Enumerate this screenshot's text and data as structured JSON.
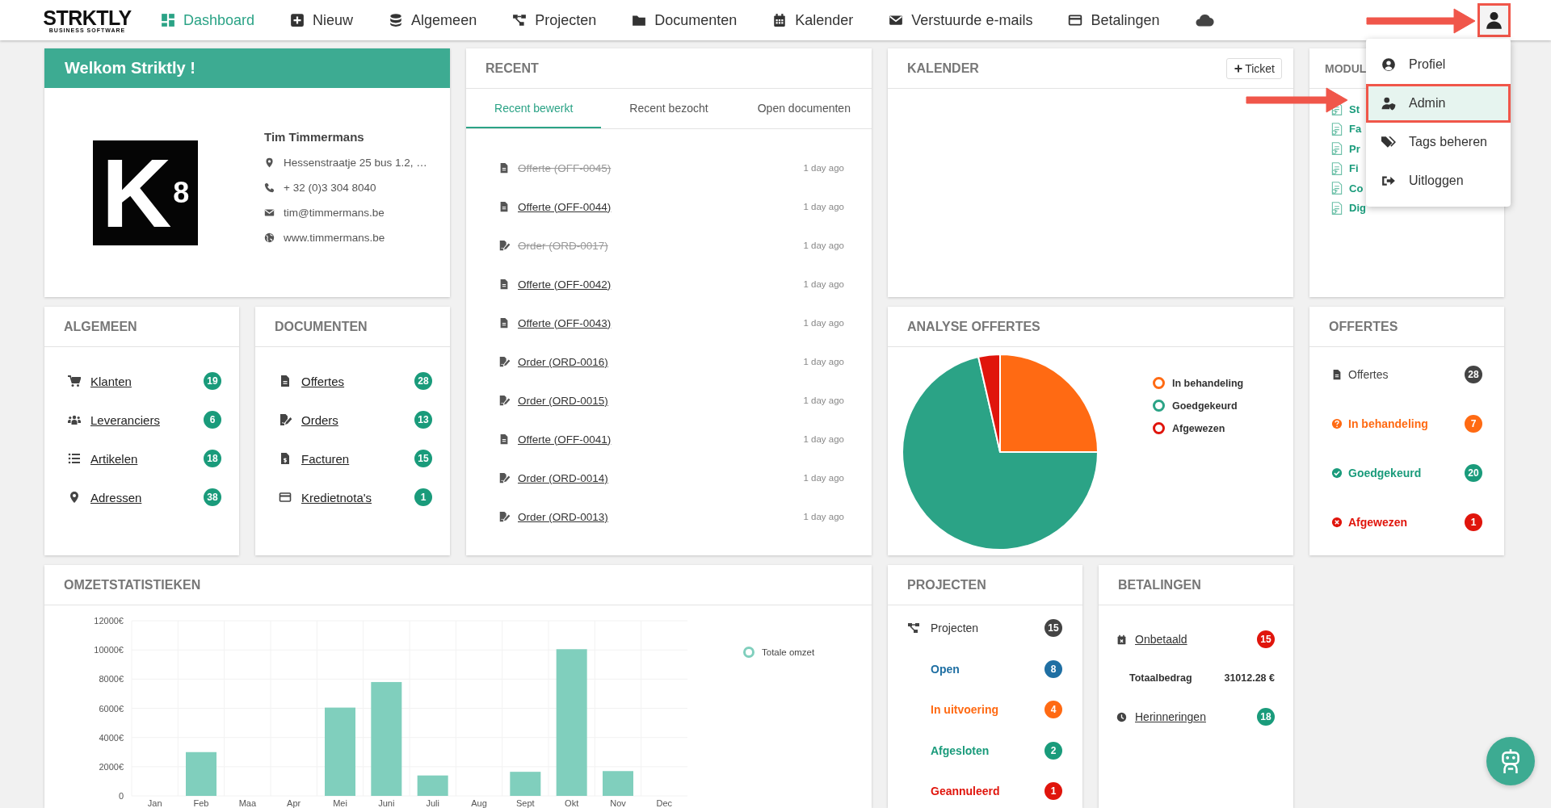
{
  "nav": {
    "logo": "STRKTLY",
    "logo_subtitle": "BUSINESS SOFTWARE",
    "items": [
      {
        "label": "Dashboard",
        "selected": true
      },
      {
        "label": "Nieuw",
        "selected": false
      },
      {
        "label": "Algemeen",
        "selected": false
      },
      {
        "label": "Projecten",
        "selected": false
      },
      {
        "label": "Documenten",
        "selected": false
      },
      {
        "label": "Kalender",
        "selected": false
      },
      {
        "label": "Verstuurde e-mails",
        "selected": false
      },
      {
        "label": "Betalingen",
        "selected": false
      }
    ],
    "user_menu": [
      {
        "label": "Profiel",
        "selected": false
      },
      {
        "label": "Admin",
        "selected": true
      },
      {
        "label": "Tags beheren",
        "selected": false
      },
      {
        "label": "Uitloggen",
        "selected": false
      }
    ]
  },
  "welcome": {
    "title": "Welkom Striktly !",
    "logo": {
      "mark": "K",
      "index": "8"
    },
    "name": "Tim Timmermans",
    "details": [
      "Hessenstraatje 25 bus 1.2, …",
      "+ 32 (0)3 304 8040",
      "tim@timmermans.be",
      "www.timmermans.be"
    ]
  },
  "recent": {
    "title": "RECENT",
    "tabs": [
      {
        "label": "Recent bewerkt",
        "selected": true
      },
      {
        "label": "Recent bezocht",
        "selected": false
      },
      {
        "label": "Open documenten",
        "selected": false
      }
    ],
    "items": [
      {
        "kind": "offerte",
        "label": "Offerte (OFF-0045)",
        "deleted": true,
        "time": "1 day ago"
      },
      {
        "kind": "offerte",
        "label": "Offerte (OFF-0044)",
        "deleted": false,
        "time": "1 day ago"
      },
      {
        "kind": "order",
        "label": "Order (ORD-0017)",
        "deleted": true,
        "time": "1 day ago"
      },
      {
        "kind": "offerte",
        "label": "Offerte (OFF-0042)",
        "deleted": false,
        "time": "1 day ago"
      },
      {
        "kind": "offerte",
        "label": "Offerte (OFF-0043)",
        "deleted": false,
        "time": "1 day ago"
      },
      {
        "kind": "order",
        "label": "Order (ORD-0016)",
        "deleted": false,
        "time": "1 day ago"
      },
      {
        "kind": "order",
        "label": "Order (ORD-0015)",
        "deleted": false,
        "time": "1 day ago"
      },
      {
        "kind": "offerte",
        "label": "Offerte (OFF-0041)",
        "deleted": false,
        "time": "1 day ago"
      },
      {
        "kind": "order",
        "label": "Order (ORD-0014)",
        "deleted": false,
        "time": "1 day ago"
      },
      {
        "kind": "order",
        "label": "Order (ORD-0013)",
        "deleted": false,
        "time": "1 day ago"
      }
    ]
  },
  "calendar": {
    "title": "KALENDER",
    "button": "Ticket"
  },
  "modules": {
    "title": "MODUL",
    "items": [
      "St",
      "Fa",
      "Pr",
      "Fi",
      "Co",
      "Dig"
    ]
  },
  "algemeen": {
    "title": "ALGEMEEN",
    "items": [
      {
        "label": "Klanten",
        "count": "19"
      },
      {
        "label": "Leveranciers",
        "count": "6"
      },
      {
        "label": "Artikelen",
        "count": "18"
      },
      {
        "label": "Adressen",
        "count": "38"
      }
    ]
  },
  "documenten": {
    "title": "DOCUMENTEN",
    "items": [
      {
        "label": "Offertes",
        "count": "28"
      },
      {
        "label": "Orders",
        "count": "13"
      },
      {
        "label": "Facturen",
        "count": "15"
      },
      {
        "label": "Kredietnota's",
        "count": "1"
      }
    ]
  },
  "analyse": {
    "title": "ANALYSE OFFERTES",
    "chart_data": {
      "type": "pie",
      "categories": [
        "In behandeling",
        "Goedgekeurd",
        "Afgewezen"
      ],
      "values": [
        25,
        71.43,
        3.57
      ],
      "colors": [
        "#ff6a13",
        "#2ba386",
        "#e0150c"
      ]
    }
  },
  "offertes": {
    "title": "OFFERTES",
    "items": [
      {
        "label": "Offertes",
        "count": "28",
        "color": "#444444"
      },
      {
        "label": "In behandeling",
        "count": "7",
        "color": "#ff6a13"
      },
      {
        "label": "Goedgekeurd",
        "count": "20",
        "color": "#1a9b7b"
      },
      {
        "label": "Afgewezen",
        "count": "1",
        "color": "#e0150c"
      }
    ]
  },
  "omzet": {
    "title": "OMZETSTATISTIEKEN",
    "chart_data": {
      "type": "bar",
      "categories": [
        "Jan",
        "Feb",
        "Maa",
        "Apr",
        "Mei",
        "Juni",
        "Juli",
        "Aug",
        "Sept",
        "Okt",
        "Nov",
        "Dec"
      ],
      "series": [
        {
          "name": "Totale omzet",
          "color": "#80cfbd",
          "values": [
            0,
            3000,
            0,
            0,
            6050,
            7800,
            1400,
            0,
            1650,
            10050,
            1700,
            0
          ]
        }
      ],
      "grid": true,
      "ylim": [
        0,
        12000
      ],
      "yticks": [
        {
          "value": 0,
          "label": "0"
        },
        {
          "value": 2000,
          "label": "2000€"
        },
        {
          "value": 4000,
          "label": "4000€"
        },
        {
          "value": 6000,
          "label": "6000€"
        },
        {
          "value": 8000,
          "label": "8000€"
        },
        {
          "value": 10000,
          "label": "10000€"
        },
        {
          "value": 12000,
          "label": "12000€"
        }
      ]
    }
  },
  "projecten": {
    "title": "PROJECTEN",
    "label": "Projecten",
    "count": "15",
    "children": [
      {
        "label": "Open",
        "count": "8",
        "color": "#1f6fa3"
      },
      {
        "label": "In uitvoering",
        "count": "4",
        "color": "#ff6a13"
      },
      {
        "label": "Afgesloten",
        "count": "2",
        "color": "#1a9b7b"
      },
      {
        "label": "Geannuleerd",
        "count": "1",
        "color": "#e0150c"
      }
    ]
  },
  "betalingen": {
    "title": "BETALINGEN",
    "items": [
      {
        "kind": "link",
        "label": "Onbetaald",
        "count": "15",
        "color": "#e0150c"
      },
      {
        "kind": "total",
        "label": "Totaalbedrag",
        "value": "31012.28 €"
      },
      {
        "kind": "link",
        "label": "Herinneringen",
        "count": "18",
        "color": "#1a9b7b"
      }
    ]
  }
}
